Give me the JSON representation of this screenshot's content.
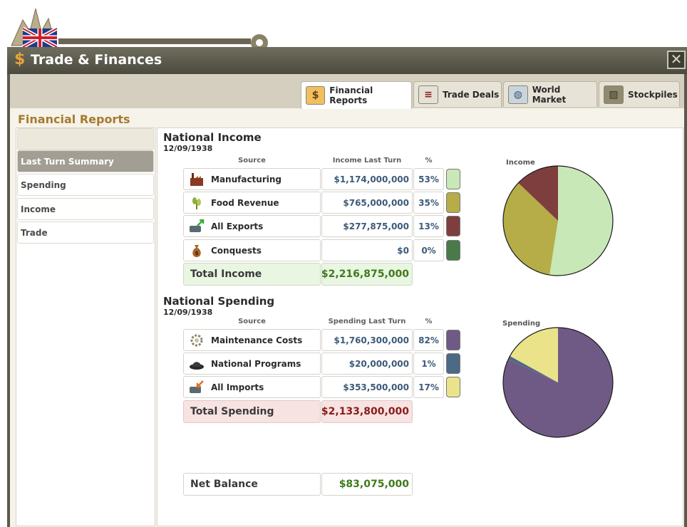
{
  "window": {
    "title": "Trade & Finances",
    "title_icon": "dollar-icon",
    "close_icon": "close-icon"
  },
  "tabs": [
    {
      "label": "Financial Reports",
      "icon": "dollar-icon",
      "active": true
    },
    {
      "label": "Trade Deals",
      "icon": "document-icon",
      "active": false
    },
    {
      "label": "World Market",
      "icon": "globe-icon",
      "active": false
    },
    {
      "label": "Stockpiles",
      "icon": "crate-icon",
      "active": false
    }
  ],
  "section_title": "Financial Reports",
  "sidebar": {
    "items": [
      {
        "label": "",
        "state": "blank"
      },
      {
        "label": "Last Turn Summary",
        "state": "active"
      },
      {
        "label": "Spending",
        "state": "normal"
      },
      {
        "label": "Income",
        "state": "normal"
      },
      {
        "label": "Trade",
        "state": "normal"
      }
    ]
  },
  "income": {
    "heading": "National Income",
    "date": "12/09/1938",
    "col_source": "Source",
    "col_value": "Income Last Turn",
    "col_pct": "%",
    "rows": [
      {
        "name": "Manufacturing",
        "value": "$1,174,000,000",
        "pct": "53%",
        "color": "#c9e8b8",
        "icon": "factory-icon"
      },
      {
        "name": "Food Revenue",
        "value": "$765,000,000",
        "pct": "35%",
        "color": "#b6ad48",
        "icon": "wheat-icon"
      },
      {
        "name": "All Exports",
        "value": "$277,875,000",
        "pct": "13%",
        "color": "#7f3e3e",
        "icon": "export-icon"
      },
      {
        "name": "Conquests",
        "value": "$0",
        "pct": "0%",
        "color": "#4a7a4a",
        "icon": "money-bag-icon"
      }
    ],
    "total_label": "Total Income",
    "total_value": "$2,216,875,000",
    "pie_label": "Income"
  },
  "spending": {
    "heading": "National Spending",
    "date": "12/09/1938",
    "col_source": "Source",
    "col_value": "Spending Last Turn",
    "col_pct": "%",
    "rows": [
      {
        "name": "Maintenance Costs",
        "value": "$1,760,300,000",
        "pct": "82%",
        "color": "#6f5a86",
        "icon": "gear-icon"
      },
      {
        "name": "National Programs",
        "value": "$20,000,000",
        "pct": "1%",
        "color": "#4b6a86",
        "icon": "hat-icon"
      },
      {
        "name": "All Imports",
        "value": "$353,500,000",
        "pct": "17%",
        "color": "#ebe38a",
        "icon": "import-icon"
      }
    ],
    "total_label": "Total Spending",
    "total_value": "$2,133,800,000",
    "pie_label": "Spending"
  },
  "net": {
    "label": "Net Balance",
    "value": "$83,075,000"
  },
  "colors": {
    "income_total_bg": "#e9f6e2",
    "income_total_value": "#3f7a1c",
    "spending_total_bg": "#f7e3e2",
    "spending_total_value": "#8a1c1c",
    "net_value": "#3f7a1c"
  }
}
